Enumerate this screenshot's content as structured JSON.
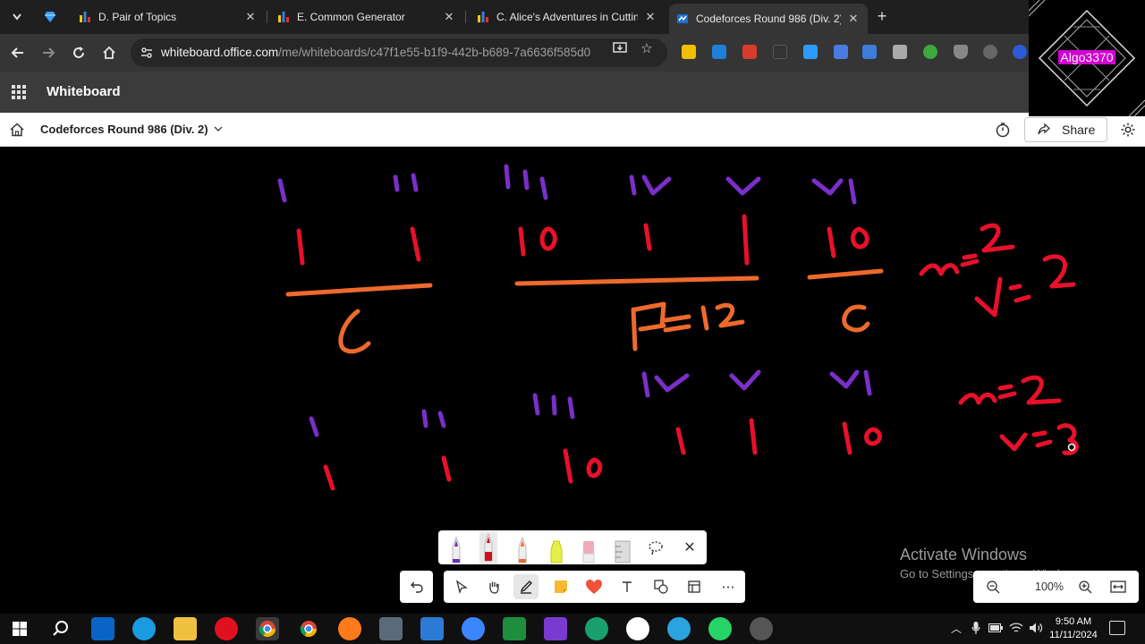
{
  "browser": {
    "tabs": [
      {
        "title": "D. Pair of Topics",
        "icon": "bar-chart-icon"
      },
      {
        "title": "E. Common Generator",
        "icon": "bar-chart-icon"
      },
      {
        "title": "C. Alice's Adventures in Cutting",
        "icon": "bar-chart-icon"
      },
      {
        "title": "Codeforces Round 986 (Div. 2)",
        "icon": "whiteboard-icon",
        "active": true
      }
    ],
    "url_host": "whiteboard.office.com",
    "url_path": "/me/whiteboards/c47f1e55-b1f9-442b-b689-7a6636f585d0"
  },
  "app": {
    "title": "Whiteboard"
  },
  "board": {
    "name": "Codeforces Round 986 (Div. 2)",
    "share_label": "Share"
  },
  "webcam": {
    "label": "Algo3370"
  },
  "zoom": {
    "value": "100%"
  },
  "watermark": {
    "line1": "Activate Windows",
    "line2": "Go to Settings to activate Windows."
  },
  "taskbar": {
    "time": "9:50 AM",
    "date": "11/11/2024"
  },
  "colors": {
    "ink_red": "#e8102a",
    "ink_purple": "#7a2fc8",
    "ink_orange": "#ee6a2c",
    "tab_bg": "#1f1f1f",
    "toolbar_bg": "#353535",
    "appbar_bg": "#3b3b3b"
  },
  "whiteboard_text": {
    "top_labels": [
      "i",
      "ii",
      "iii",
      "iv",
      "v",
      "vi"
    ],
    "top_values": [
      "1",
      "1",
      "10",
      "1",
      "1",
      "10"
    ],
    "segment_labels": [
      "c",
      "A=12",
      "c"
    ],
    "note1": [
      "m=2",
      "v=2"
    ],
    "bottom_labels": [
      "i",
      "ii",
      "iii",
      "iv",
      "v",
      "vi"
    ],
    "bottom_values": [
      "1",
      "1",
      "10",
      "1",
      "1",
      "10"
    ],
    "note2": [
      "m=2",
      "v=3"
    ]
  }
}
